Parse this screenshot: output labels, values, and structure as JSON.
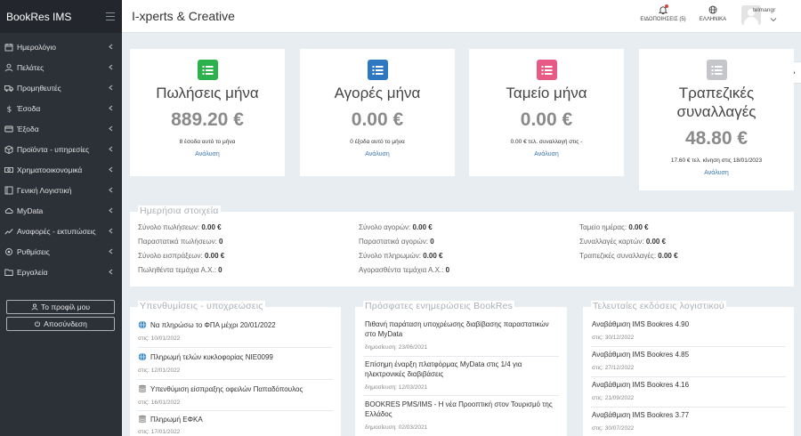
{
  "app": {
    "brand": "BookRes IMS",
    "company": "I-xperts & Creative"
  },
  "header": {
    "notifications_label": "ΕΙΔΟΠΟΙΗΣΕΙΣ (5)",
    "language_label": "ΕΛΛΗΝΙΚΑ",
    "username": "telmangr"
  },
  "sidebar": {
    "items": [
      {
        "label": "Ημερολόγιο",
        "icon": "calendar-icon"
      },
      {
        "label": "Πελάτες",
        "icon": "user-icon"
      },
      {
        "label": "Προμηθευτές",
        "icon": "truck-icon"
      },
      {
        "label": "Έσοδα",
        "icon": "dollar-icon"
      },
      {
        "label": "Έξοδα",
        "icon": "credit-card-icon"
      },
      {
        "label": "Προϊόντα - υπηρεσίες",
        "icon": "box-icon"
      },
      {
        "label": "Χρηματοοικονομικά",
        "icon": "money-icon"
      },
      {
        "label": "Γενική Λογιστική",
        "icon": "book-icon"
      },
      {
        "label": "MyData",
        "icon": "cloud-icon"
      },
      {
        "label": "Αναφορές - εκτυπώσεις",
        "icon": "chart-line-icon"
      },
      {
        "label": "Ρυθμίσεις",
        "icon": "settings-icon"
      },
      {
        "label": "Εργαλεία",
        "icon": "folder-icon"
      }
    ],
    "profile_button": "Το προφίλ μου",
    "logout_button": "Αποσύνδεση"
  },
  "stats": [
    {
      "title": "Πωλήσεις μήνα",
      "value": "889.20 €",
      "sub": "8 έσοδα αυτό το μήνα",
      "link": "Ανάλυση",
      "color": "#2bb24c"
    },
    {
      "title": "Αγορές μήνα",
      "value": "0.00 €",
      "sub": "0 έξοδα αυτό το μήνα",
      "link": "Ανάλυση",
      "color": "#2e78c2"
    },
    {
      "title": "Ταμείο μήνα",
      "value": "0.00 €",
      "sub": "0.00 € τελ. συναλλαγή στις -",
      "link": "Ανάλυση",
      "color": "#e85a86"
    },
    {
      "title": "Τραπεζικές συναλλαγές",
      "value": "48.80 €",
      "sub": "17.60 € τελ. κίνηση στις 18/01/2023",
      "link": "Ανάλυση",
      "color": "#c4c6c9"
    }
  ],
  "daily": {
    "title": "Ημερήσια στοιχεία",
    "col1": [
      {
        "label": "Σύνολο πωλήσεων:",
        "value": "0.00 €"
      },
      {
        "label": "Παραστατικά πωλήσεων:",
        "value": "0"
      },
      {
        "label": "Σύνολο εισπράξεων:",
        "value": "0.00 €"
      },
      {
        "label": "Πωληθέντα τεμάχια Α.Χ.:",
        "value": "0"
      }
    ],
    "col2": [
      {
        "label": "Σύνολο αγορών:",
        "value": "0.00 €"
      },
      {
        "label": "Παραστατικά αγορών:",
        "value": "0"
      },
      {
        "label": "Σύνολο πληρωμών:",
        "value": "0.00 €"
      },
      {
        "label": "Αγορασθέντα τεμάχια Α.Χ.:",
        "value": "0"
      }
    ],
    "col3": [
      {
        "label": "Ταμείο ημέρας:",
        "value": "0.00 €"
      },
      {
        "label": "Συναλλαγές καρτών:",
        "value": "0.00 €"
      },
      {
        "label": "Τραπεζικές συναλλαγές:",
        "value": "0.00 €"
      }
    ]
  },
  "reminders": {
    "title": "Υπενθυμίσεις - υποχρεώσεις",
    "items": [
      {
        "title": "Να πληρώσω το ΦΠΑ μέχρι 20/01/2022",
        "date": "στις: 10/01/2022",
        "icon": "globe-icon"
      },
      {
        "title": "Πληρωμή τελών κυκλοφορίας ΝΙΕ0099",
        "date": "στις: 12/01/2022",
        "icon": "globe-icon"
      },
      {
        "title": "Υπενθύμιση είσπραξης οφειλών Παπαδόπουλος",
        "date": "στις: 16/01/2022",
        "icon": "database-icon"
      },
      {
        "title": "Πληρωμή ΕΦΚΑ",
        "date": "στις: 17/01/2022",
        "icon": "database-icon"
      }
    ]
  },
  "news": {
    "title": "Πρόσφατες ενημερώσεις BookRes",
    "items": [
      {
        "title": "Πιθανή παράταση υποχρέωσης διαβίβασης παραστατικών στο MyData",
        "date": "δημοσίευση: 23/06/2021"
      },
      {
        "title": "Επίσημη έναρξη πλατφόρμας MyData στις 1/4 για ηλεκτρονικές διαβιβάσεις",
        "date": "δημοσίευση: 12/03/2021"
      },
      {
        "title": "BOOKRES PMS/IMS - Η νέα Προοπτική στον Τουρισμό της Ελλάδος",
        "date": "δημοσίευση: 02/03/2021"
      }
    ]
  },
  "versions": {
    "title": "Τελευταίες εκδόσεις λογιστικού",
    "items": [
      {
        "title": "Αναβάθμιση IMS Bookres 4.90",
        "date": "στις: 30/12/2022"
      },
      {
        "title": "Αναβάθμιση IMS Bookres 4.85",
        "date": "στις: 27/12/2022"
      },
      {
        "title": "Αναβάθμιση IMS Bookres 4.16",
        "date": "στις: 21/09/2022"
      },
      {
        "title": "Αναβάθμιση IMS Bookres 3.77",
        "date": "στις: 30/07/2022"
      }
    ]
  }
}
